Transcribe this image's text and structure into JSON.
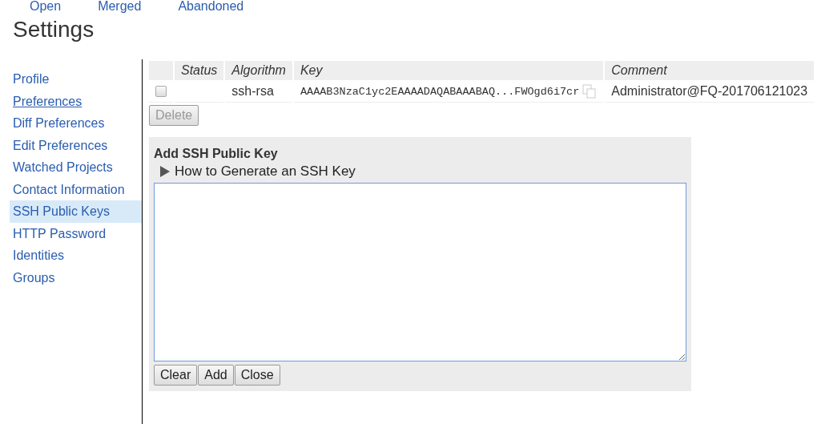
{
  "top_tabs": [
    {
      "label": "Open"
    },
    {
      "label": "Merged"
    },
    {
      "label": "Abandoned"
    }
  ],
  "title": "Settings",
  "sidebar": {
    "items": [
      {
        "label": "Profile",
        "selected": false,
        "hovered": false
      },
      {
        "label": "Preferences",
        "selected": false,
        "hovered": true
      },
      {
        "label": "Diff Preferences",
        "selected": false,
        "hovered": false
      },
      {
        "label": "Edit Preferences",
        "selected": false,
        "hovered": false
      },
      {
        "label": "Watched Projects",
        "selected": false,
        "hovered": false
      },
      {
        "label": "Contact Information",
        "selected": false,
        "hovered": false
      },
      {
        "label": "SSH Public Keys",
        "selected": true,
        "hovered": false
      },
      {
        "label": "HTTP Password",
        "selected": false,
        "hovered": false
      },
      {
        "label": "Identities",
        "selected": false,
        "hovered": false
      },
      {
        "label": "Groups",
        "selected": false,
        "hovered": false
      }
    ]
  },
  "keys_table": {
    "columns": [
      "Status",
      "Algorithm",
      "Key",
      "Comment"
    ],
    "rows": [
      {
        "checked": false,
        "status": "",
        "algorithm": "ssh-rsa",
        "key": "AAAAB3NzaC1yc2EAAAADAQABAAABAQ...FWOgd6i7cr",
        "comment": "Administrator@FQ-201706121023"
      }
    ]
  },
  "delete_button": {
    "label": "Delete",
    "disabled": true
  },
  "add_panel": {
    "title": "Add SSH Public Key",
    "help_link": {
      "label": "How to Generate an SSH Key",
      "expanded": false
    },
    "buttons": [
      "Clear",
      "Add",
      "Close"
    ]
  }
}
